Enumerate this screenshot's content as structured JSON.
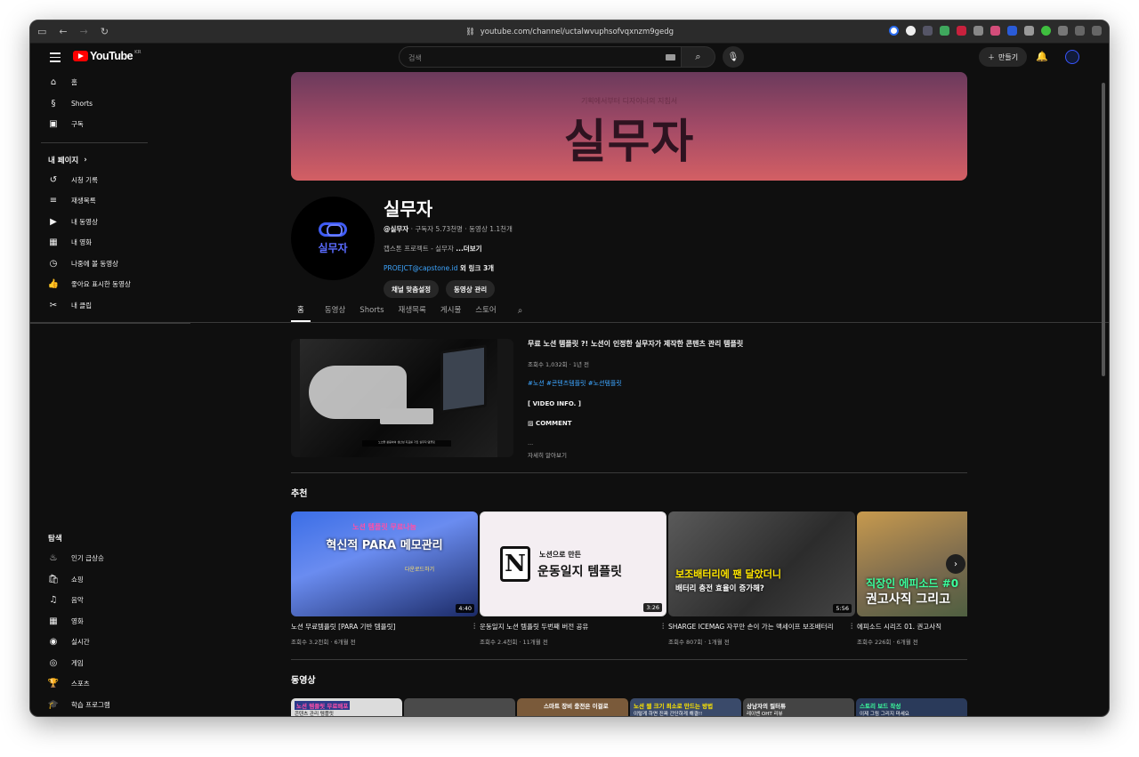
{
  "browser": {
    "url": "youtube.com/channel/uctalwvuphsofvqxnzm9gedg"
  },
  "topbar": {
    "logo_text": "YouTube",
    "region": "KR",
    "search_placeholder": "검색",
    "create_label": "만들기"
  },
  "sidebar": {
    "main": [
      {
        "label": "홈",
        "icon": "home-icon"
      },
      {
        "label": "Shorts",
        "icon": "shorts-icon"
      },
      {
        "label": "구독",
        "icon": "subscriptions-icon"
      }
    ],
    "you_header": "내 페이지",
    "you": [
      {
        "label": "시청 기록",
        "icon": "history-icon"
      },
      {
        "label": "재생목록",
        "icon": "playlists-icon"
      },
      {
        "label": "내 동영상",
        "icon": "your-videos-icon"
      },
      {
        "label": "내 영화",
        "icon": "movies-icon"
      },
      {
        "label": "나중에 볼 동영상",
        "icon": "watch-later-icon"
      },
      {
        "label": "좋아요 표시한 동영상",
        "icon": "liked-icon"
      },
      {
        "label": "내 클립",
        "icon": "clips-icon"
      }
    ],
    "explore_header": "탐색",
    "explore": [
      {
        "label": "인기 급상승",
        "icon": "trending-icon"
      },
      {
        "label": "쇼핑",
        "icon": "shopping-icon"
      },
      {
        "label": "음악",
        "icon": "music-icon"
      },
      {
        "label": "영화",
        "icon": "film-icon"
      },
      {
        "label": "실시간",
        "icon": "live-icon"
      },
      {
        "label": "게임",
        "icon": "gaming-icon"
      },
      {
        "label": "스포츠",
        "icon": "sports-icon"
      },
      {
        "label": "학습 프로그램",
        "icon": "learning-icon"
      }
    ]
  },
  "banner": {
    "subtitle": "기획에서부터 디자이너의 지침서",
    "title": "실무자"
  },
  "channel": {
    "name": "실무자",
    "avatar_text": "실무자",
    "handle": "@실무자",
    "subscribers": "구독자 5.73천명",
    "videos": "동영상 1.1천개",
    "description": "캡스톤 프로젝트 - 실무자 ",
    "more": "...더보기",
    "link": "PROEJCT@capstone.id",
    "link_more": " 외 링크 3개",
    "customize": "채널 맞춤설정",
    "manage": "동영상 관리"
  },
  "tabs": [
    "홈",
    "동영상",
    "Shorts",
    "재생목록",
    "게시물",
    "스토어"
  ],
  "featured": {
    "title": "무료 노션 템플릿 ?! 노션이 인정한 실무자가 제작한 콘텐츠 관리 템플릿",
    "views": "조회수 1,032회",
    "age": "1년 전",
    "tags": "#노션 #콘텐츠템플릿 #노션템플릿",
    "info_line": "[ VIDEO INFO. ]",
    "comment_line": "▨ COMMENT",
    "ellipsis": "...",
    "more": "자세히 알아보기",
    "caption": "노션을 활용하여 생산성 지표를 가진 실무자 템플릿"
  },
  "recommended": {
    "title": "추천",
    "items": [
      {
        "title": "노션 무료템플릿 [PARA 기반 템플릿]",
        "views": "조회수 3.2천회",
        "age": "6개월 전",
        "duration": "4:40",
        "overlay_top": "노션 템플릿 무료나눔",
        "overlay_main": "혁신적 PARA 메모관리",
        "badge": "다운로드하기"
      },
      {
        "title": "운동일지 노션 템플릿 두번째 버전 공유",
        "views": "조회수 2.4천회",
        "age": "11개월 전",
        "duration": "3:26",
        "overlay_top": "노션으로 만든",
        "overlay_main": "운동일지 템플릿",
        "badge": "N"
      },
      {
        "title": "SHARGE ICEMAG 자꾸만 손이 가는 맥세이프 보조배터리",
        "views": "조회수 807회",
        "age": "1개월 전",
        "duration": "5:56",
        "overlay_top": "보조배터리에 팬 달았더니",
        "overlay_main": "배터리 충전 효율이 증가해?",
        "badge": ""
      },
      {
        "title": "에피소드 시리즈 01. 권고사직",
        "views": "조회수 226회",
        "age": "6개월 전",
        "duration": "",
        "overlay_top": "직장인 에피소드 #0",
        "overlay_main": "권고사직 그리고",
        "badge": ""
      }
    ]
  },
  "videos_section": {
    "title": "동영상",
    "items": [
      {
        "top": "노션 템플릿 무료배포",
        "sub": "콘텐츠 관리 템플릿"
      },
      {
        "top": "",
        "sub": ""
      },
      {
        "top": "스마트 장비 충전은 이걸로",
        "sub": "종결"
      },
      {
        "top": "노션 웹 크기 최소로 만드는 방법",
        "sub": "이렇게 하면 진짜 간단하게 해결!!"
      },
      {
        "top": "상남자의 필터튜",
        "sub": "레이밴 OHT 리뷰"
      },
      {
        "top": "스토리 보드 작성",
        "sub": "이제 그림 그리지 마세요"
      }
    ]
  },
  "colors": {
    "background": "#0f0f0f",
    "brand_red": "#ff0000",
    "link_blue": "#3ea6ff",
    "banner_top": "#6b3a5c",
    "banner_bottom": "#d35f64"
  }
}
